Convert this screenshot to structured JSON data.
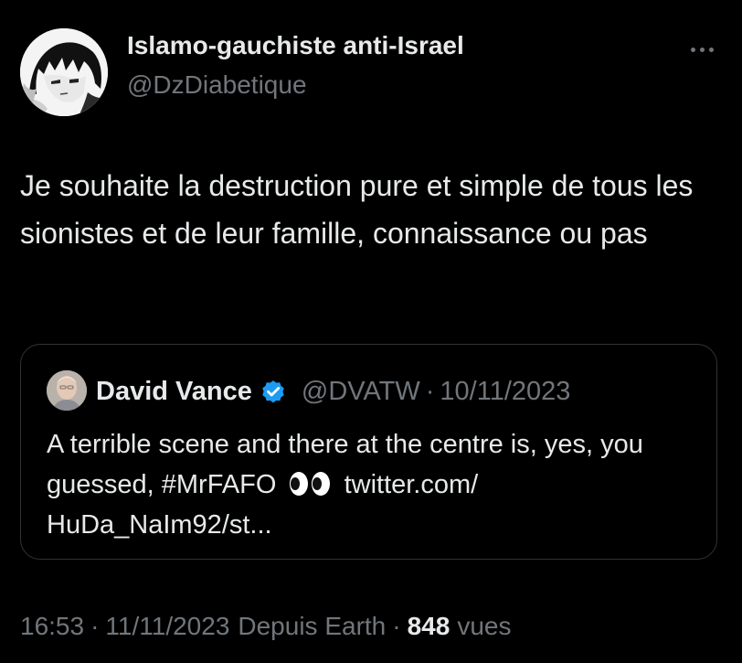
{
  "tweet": {
    "author": {
      "display_name": "Islamo-gauchiste anti-Israel",
      "handle": "@DzDiabetique",
      "avatar": "manga-character-avatar"
    },
    "more_icon": "more-options-icon",
    "text": "Je souhaite la destruction pure et simple de tous les sionistes et de leur famille, connaissance ou pas",
    "quoted": {
      "display_name": "David Vance",
      "verified_icon": "verified-badge-icon",
      "verified_color": "#1d9bf0",
      "handle": "@DVATW",
      "separator": "·",
      "date": "10/11/2023",
      "text_before": "A terrible scene and there at the centre is, yes, you guessed, #MrFAFO",
      "emoji": "eyes-emoji",
      "text_after": "twitter.com/ HuDa_NaIm92/st..."
    },
    "footer": {
      "time": "16:53",
      "separator": "·",
      "date": "11/11/2023",
      "source": "Depuis Earth",
      "views_count": "848",
      "views_label": "vues"
    }
  },
  "colors": {
    "background": "#000000",
    "primary_text": "#e7e9ea",
    "secondary_text": "#71767b",
    "border": "#2f3336",
    "accent": "#1d9bf0"
  }
}
